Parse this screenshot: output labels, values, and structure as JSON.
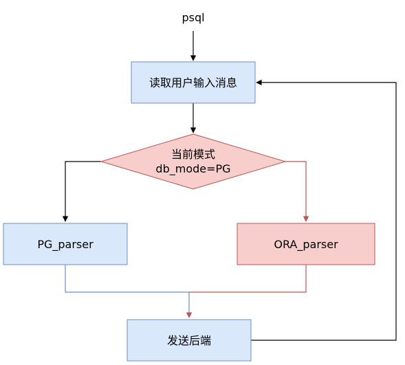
{
  "diagram": {
    "start_label": "psql",
    "read_input": "读取用户输入消息",
    "decision": {
      "line1": "当前模式",
      "line2": "db_mode=PG"
    },
    "pg_parser": "PG_parser",
    "ora_parser": "ORA_parser",
    "send_backend": "发送后端"
  },
  "colors": {
    "blue_fill": "#dae8fc",
    "blue_stroke": "#6c8ebf",
    "red_fill": "#f8cecc",
    "red_stroke": "#b85450",
    "black_edge": "#000000",
    "red_edge": "#b85450"
  }
}
